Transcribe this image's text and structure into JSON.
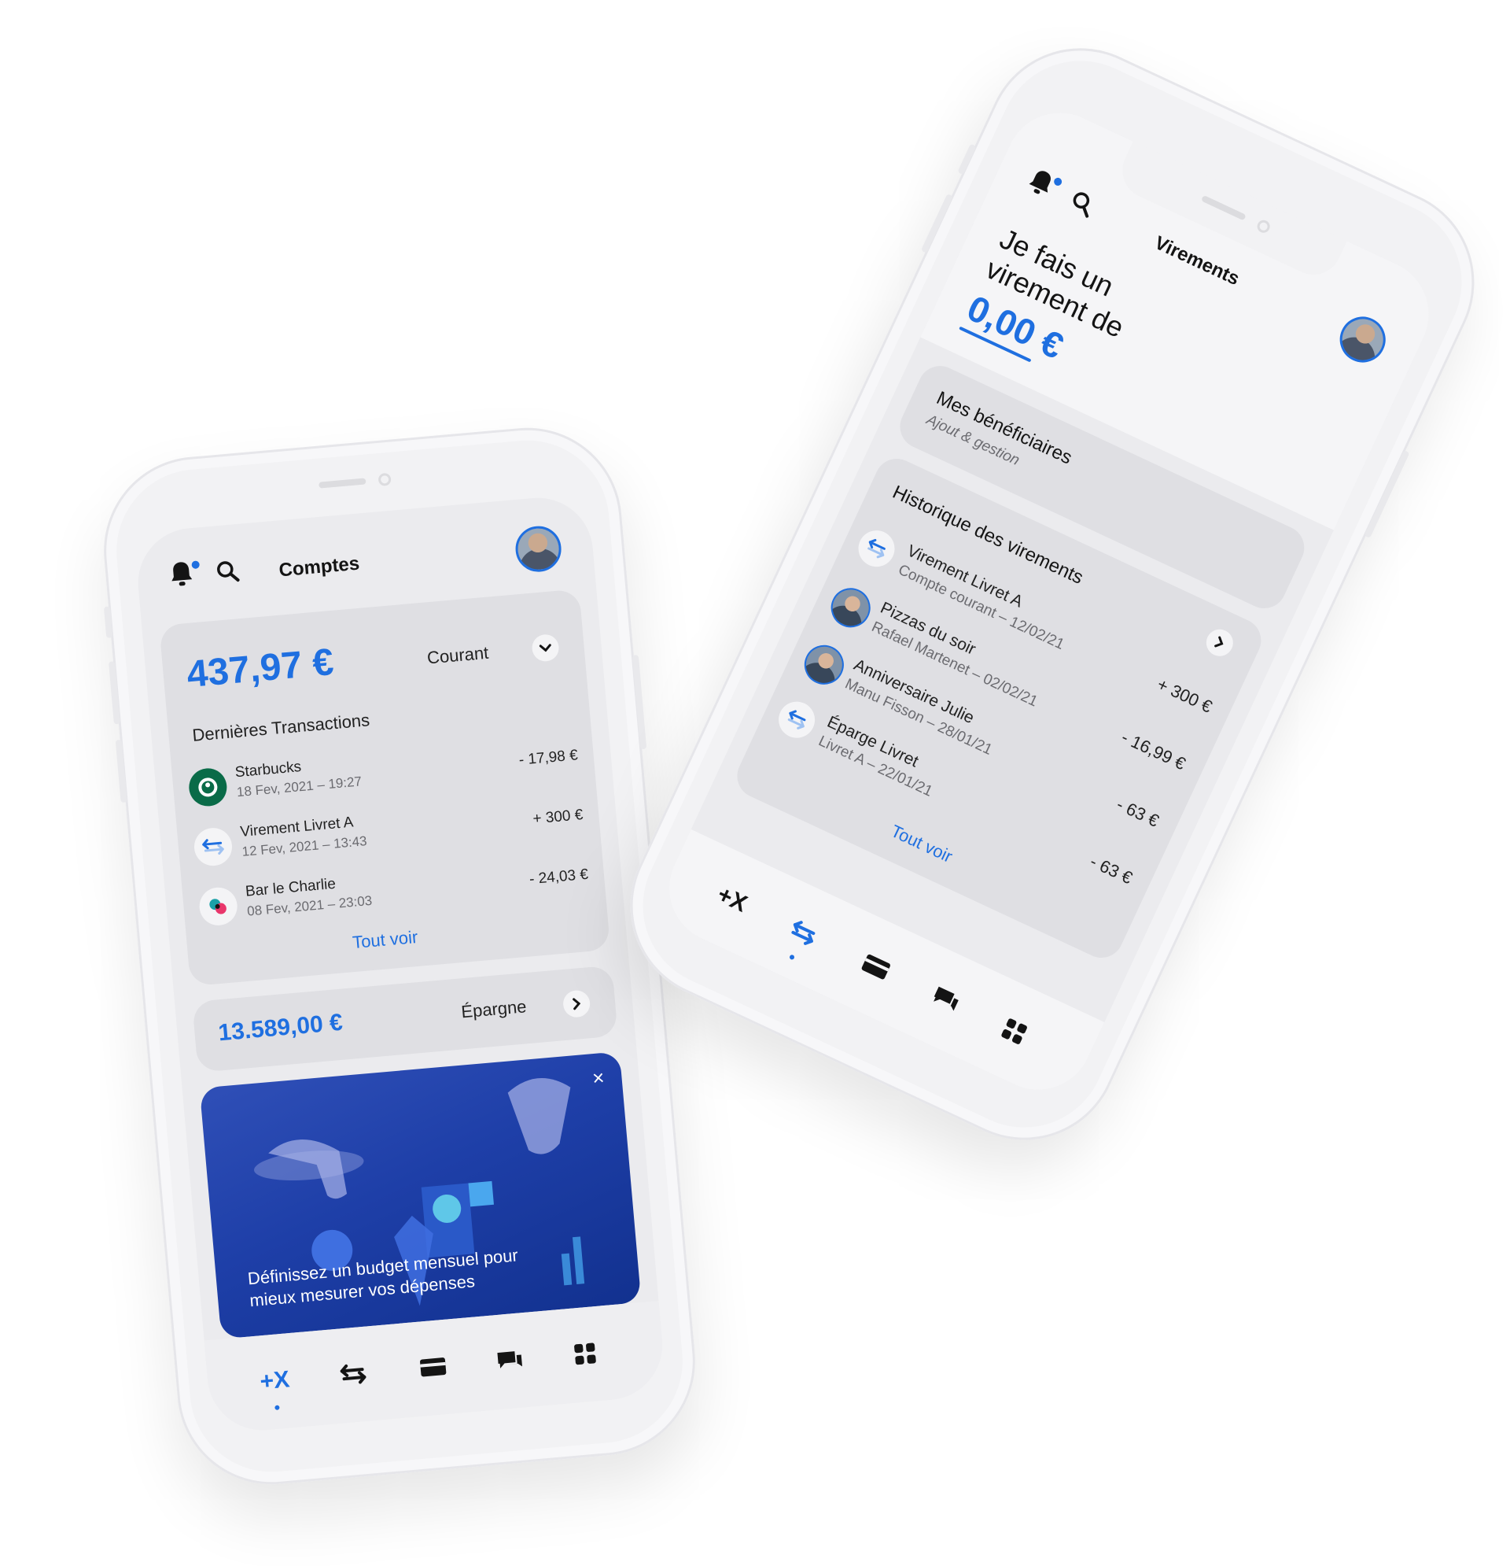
{
  "phone_left": {
    "title": "Comptes",
    "balance": "437,97 €",
    "account_type": "Courant",
    "transactions_title": "Dernières Transactions",
    "transactions": [
      {
        "name": "Starbucks",
        "date": "18 Fev, 2021 – 19:27",
        "amount": "- 17,98 €",
        "icon": "starbucks-logo-icon"
      },
      {
        "name": "Virement Livret A",
        "date": "12 Fev, 2021 – 13:43",
        "amount": "+ 300 €",
        "icon": "transfer-arrows-icon"
      },
      {
        "name": "Bar le Charlie",
        "date": "08 Fev, 2021 – 23:03",
        "amount": "- 24,03 €",
        "icon": "bar-logo-icon"
      }
    ],
    "see_all": "Tout voir",
    "savings_balance": "13.589,00 €",
    "savings_label": "Épargne",
    "promo_text": "Définissez un budget mensuel pour mieux mesurer vos dépenses",
    "promo_close": "×",
    "nav": [
      {
        "label": "+X",
        "icon": "plusx-icon",
        "active": true
      },
      {
        "label": "",
        "icon": "transfer-icon",
        "active": false
      },
      {
        "label": "",
        "icon": "card-icon",
        "active": false
      },
      {
        "label": "",
        "icon": "chat-icon",
        "active": false
      },
      {
        "label": "",
        "icon": "grid-icon",
        "active": false
      }
    ]
  },
  "phone_right": {
    "title": "Virements",
    "prompt_line1": "Je fais un",
    "prompt_line2": "virement de",
    "amount": "0,00 €",
    "beneficiaries_title": "Mes bénéficiaires",
    "beneficiaries_sub": "Ajout & gestion",
    "history_title": "Historique des virements",
    "history": [
      {
        "name": "Virement Livret A",
        "sub": "Compte courant – 12/02/21",
        "amount": "+ 300 €",
        "icon": "transfer-arrows-icon"
      },
      {
        "name": "Pizzas du soir",
        "sub": "Rafael Martenet – 02/02/21",
        "amount": "- 16,99 €",
        "icon": "avatar-rafael"
      },
      {
        "name": "Anniversaire Julie",
        "sub": "Manu Fisson – 28/01/21",
        "amount": "- 63 €",
        "icon": "avatar-manu"
      },
      {
        "name": "Éparge Livret",
        "sub": "Livret A – 22/01/21",
        "amount": "- 63 €",
        "icon": "transfer-arrows-icon"
      }
    ],
    "see_all": "Tout voir",
    "nav": [
      {
        "label": "+X",
        "icon": "plusx-icon",
        "active": false
      },
      {
        "label": "",
        "icon": "transfer-icon",
        "active": true
      },
      {
        "label": "",
        "icon": "card-icon",
        "active": false
      },
      {
        "label": "",
        "icon": "chat-icon",
        "active": false
      },
      {
        "label": "",
        "icon": "grid-icon",
        "active": false
      }
    ]
  },
  "colors": {
    "accent": "#1f6fe0",
    "card": "#dfdfe3",
    "screen": "#ebebee",
    "promo": "#1e3fa8"
  }
}
